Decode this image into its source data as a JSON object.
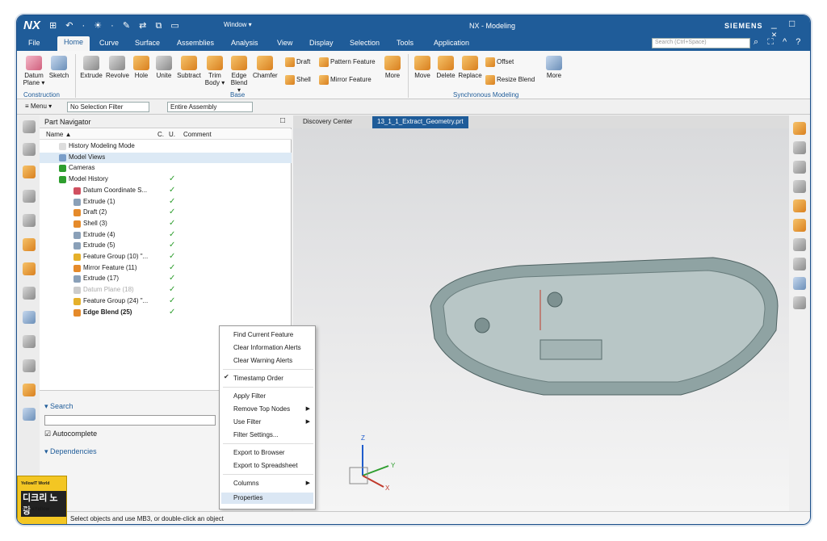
{
  "titlebar": {
    "logo": "NX",
    "app_title": "NX - Modeling",
    "brand": "SIEMENS",
    "window_menu": "Window ▾",
    "qat": "⊞ ↶ · ☀ · ✎ ⇄ ⧉ ▭",
    "controls": "_ □ ×"
  },
  "menubar": {
    "tabs": [
      "File",
      "Home",
      "Curve",
      "Surface",
      "Assemblies",
      "Analysis",
      "View",
      "Display",
      "Selection",
      "Tools",
      "Application"
    ],
    "active": "Home",
    "search_placeholder": "Search (Ctrl+Space)",
    "icons": "⌕ ⛶ ^ ?"
  },
  "ribbon": {
    "buttons": [
      "Datum Plane ▾",
      "Sketch",
      "Extrude",
      "Revolve",
      "Hole",
      "Unite",
      "Subtract",
      "Trim Body ▾",
      "Edge Blend ▾",
      "Chamfer",
      "More",
      "Move",
      "Delete",
      "Replace",
      "More"
    ],
    "small_buttons": [
      "Draft",
      "Pattern Feature",
      "Shell",
      "Mirror Feature",
      "Offset",
      "Resize Blend"
    ],
    "groups": [
      "Construction",
      "Base",
      "Synchronous Modeling"
    ]
  },
  "toolbar2": {
    "menu": "≡ Menu ▾",
    "filter": "No Selection Filter",
    "assembly": "Entire Assembly"
  },
  "navigator": {
    "title": "Part Navigator",
    "columns": [
      "Name ▲",
      "C.",
      "U.",
      "Comment"
    ],
    "rows": [
      "History Modeling Mode",
      "Model Views",
      "Cameras",
      "Model History",
      "Datum Coordinate S...",
      "Extrude (1)",
      "Draft (2)",
      "Shell (3)",
      "Extrude (4)",
      "Extrude (5)",
      "Feature Group (10) \"...",
      "Mirror Feature (11)",
      "Extrude (17)",
      "Datum Plane (18)",
      "Feature Group (24) \"...",
      "Edge Blend (25)"
    ],
    "search_label": "Search",
    "autocomplete": "Autocomplete",
    "dependencies": "Dependencies"
  },
  "context_menu": [
    "Find Current Feature",
    "Clear Information Alerts",
    "Clear Warning Alerts",
    "Timestamp Order",
    "Apply Filter",
    "Remove Top Nodes",
    "Use Filter",
    "Filter Settings...",
    "Export to Browser",
    "Export to Spreadsheet",
    "Columns",
    "Properties"
  ],
  "tabs": [
    "Discovery Center",
    "13_1_1_Extract_Geometry.prt"
  ],
  "triad": {
    "z": "Z",
    "y": "Y",
    "x": "X"
  },
  "status": "Select objects and use MB3, or double-click an object",
  "watermark": {
    "line1": "YellowIT World",
    "line2": "디크리 노랑",
    "line3": "DecreYellow"
  },
  "colors": {
    "title_bar": "#1f5c99",
    "check": "#2e9e2e",
    "viewport": "#e3e4e5"
  }
}
